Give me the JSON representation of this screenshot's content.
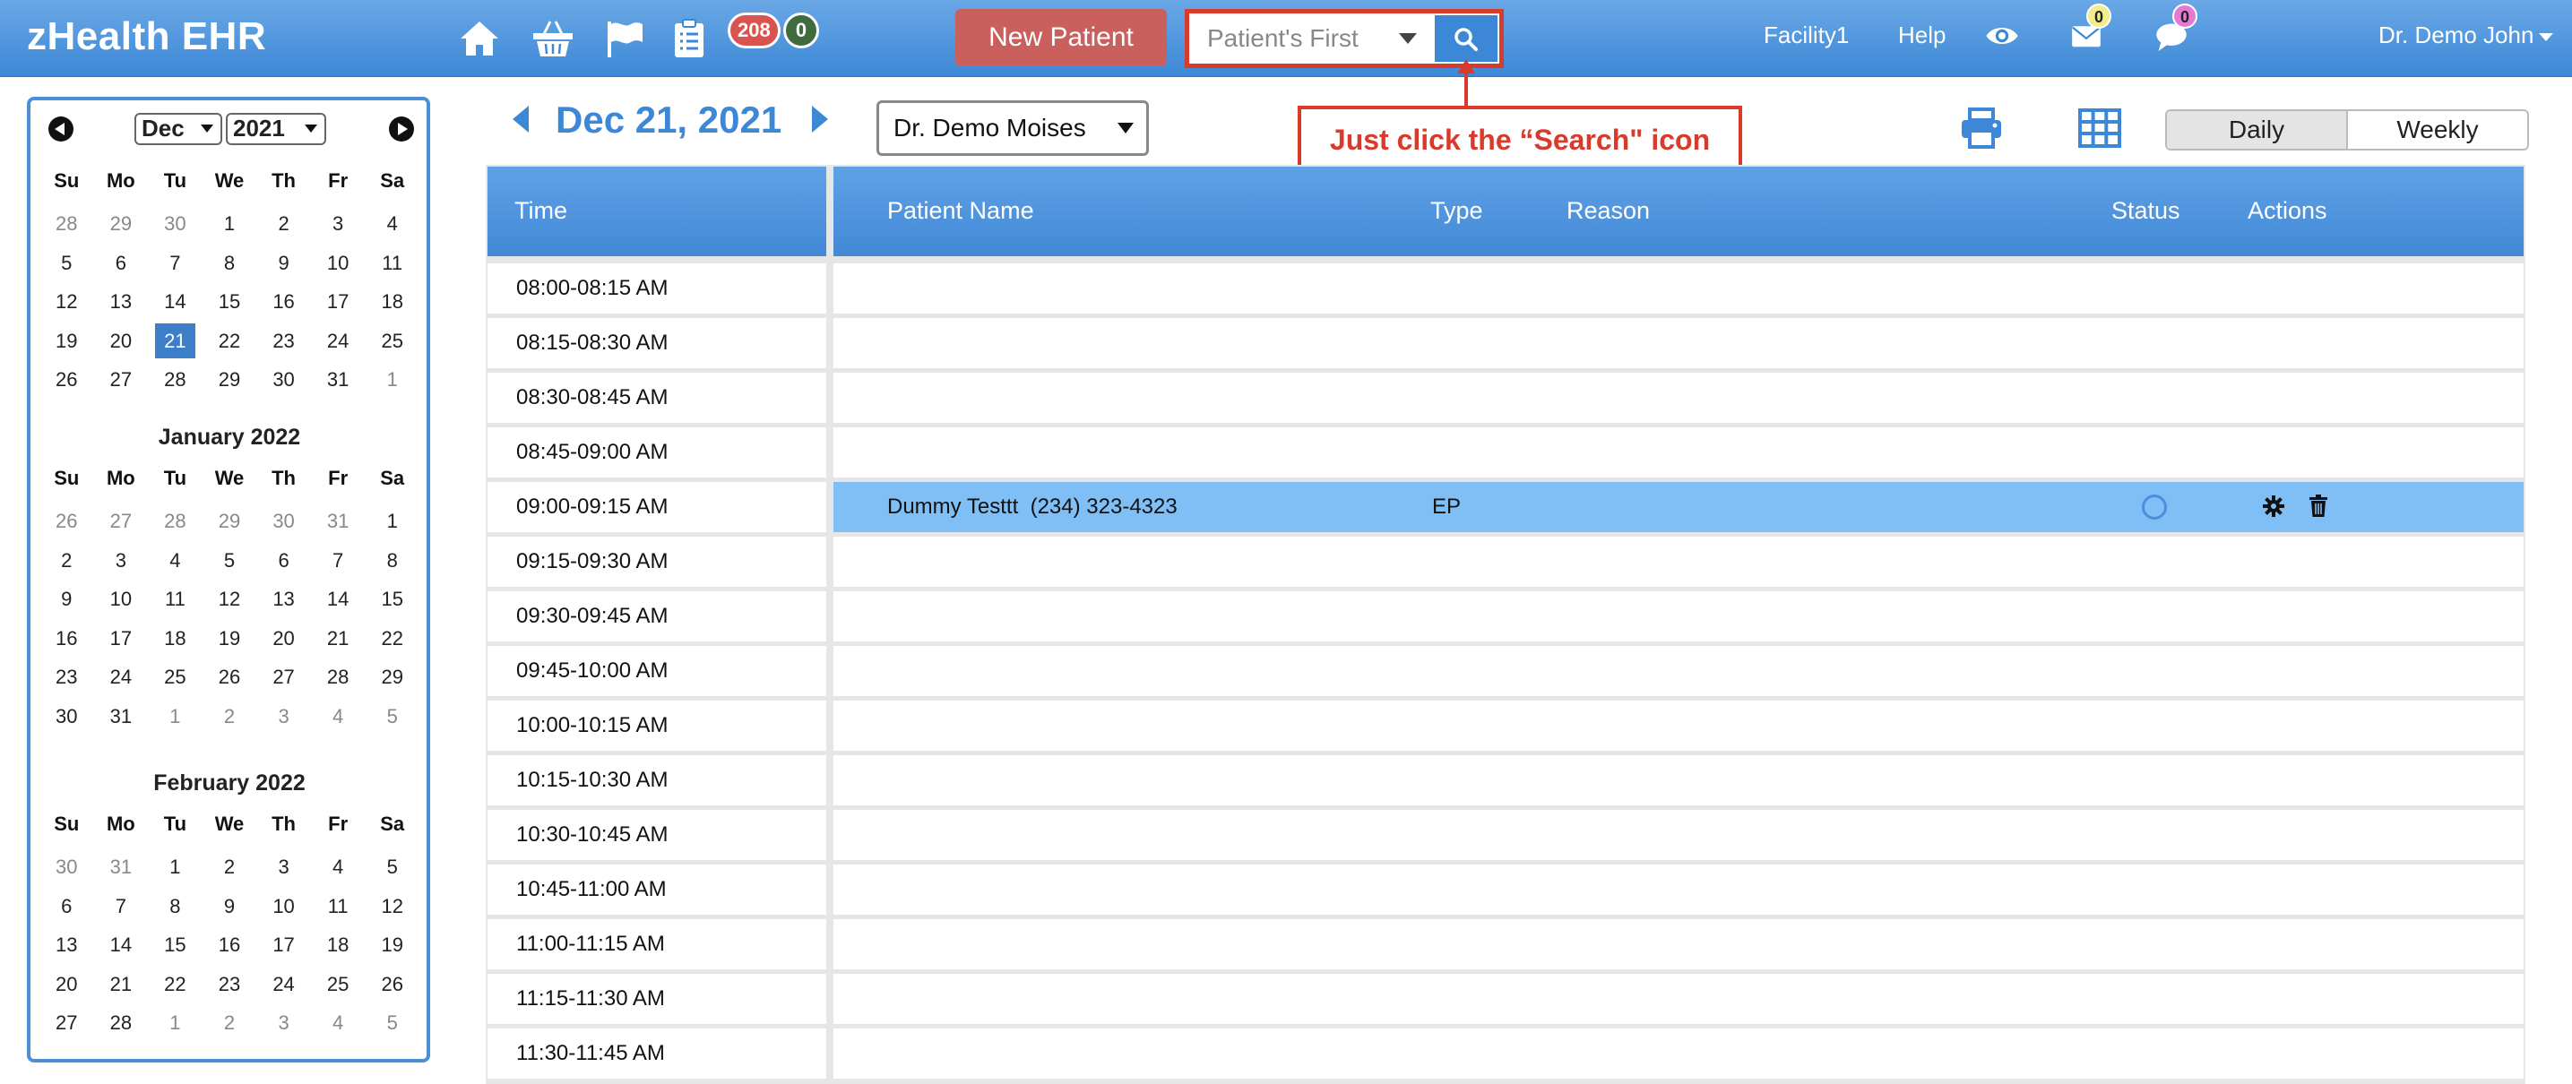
{
  "header": {
    "brand": "zHealth EHR",
    "badge_red": "208",
    "badge_green": "0",
    "new_patient_label": "New Patient",
    "search_placeholder": "Patient's First",
    "facility": "Facility1",
    "help": "Help",
    "mail_count": "0",
    "chat_count": "0",
    "user": "Dr. Demo John"
  },
  "calendar": {
    "selected_month": "Dec",
    "selected_year": "2021",
    "weekdays": [
      "Su",
      "Mo",
      "Tu",
      "We",
      "Th",
      "Fr",
      "Sa"
    ],
    "months": [
      {
        "title": "",
        "days": [
          [
            "28",
            "m"
          ],
          [
            "29",
            "m"
          ],
          [
            "30",
            "m"
          ],
          [
            "1",
            ""
          ],
          [
            "2",
            ""
          ],
          [
            "3",
            ""
          ],
          [
            "4",
            ""
          ],
          [
            "5",
            ""
          ],
          [
            "6",
            ""
          ],
          [
            "7",
            ""
          ],
          [
            "8",
            ""
          ],
          [
            "9",
            ""
          ],
          [
            "10",
            ""
          ],
          [
            "11",
            ""
          ],
          [
            "12",
            ""
          ],
          [
            "13",
            ""
          ],
          [
            "14",
            ""
          ],
          [
            "15",
            ""
          ],
          [
            "16",
            ""
          ],
          [
            "17",
            ""
          ],
          [
            "18",
            ""
          ],
          [
            "19",
            ""
          ],
          [
            "20",
            ""
          ],
          [
            "21",
            "s"
          ],
          [
            "22",
            ""
          ],
          [
            "23",
            ""
          ],
          [
            "24",
            ""
          ],
          [
            "25",
            ""
          ],
          [
            "26",
            ""
          ],
          [
            "27",
            ""
          ],
          [
            "28",
            ""
          ],
          [
            "29",
            ""
          ],
          [
            "30",
            ""
          ],
          [
            "31",
            ""
          ],
          [
            "1",
            "m"
          ]
        ]
      },
      {
        "title": "January 2022",
        "days": [
          [
            "26",
            "m"
          ],
          [
            "27",
            "m"
          ],
          [
            "28",
            "m"
          ],
          [
            "29",
            "m"
          ],
          [
            "30",
            "m"
          ],
          [
            "31",
            "m"
          ],
          [
            "1",
            ""
          ],
          [
            "2",
            ""
          ],
          [
            "3",
            ""
          ],
          [
            "4",
            ""
          ],
          [
            "5",
            ""
          ],
          [
            "6",
            ""
          ],
          [
            "7",
            ""
          ],
          [
            "8",
            ""
          ],
          [
            "9",
            ""
          ],
          [
            "10",
            ""
          ],
          [
            "11",
            ""
          ],
          [
            "12",
            ""
          ],
          [
            "13",
            ""
          ],
          [
            "14",
            ""
          ],
          [
            "15",
            ""
          ],
          [
            "16",
            ""
          ],
          [
            "17",
            ""
          ],
          [
            "18",
            ""
          ],
          [
            "19",
            ""
          ],
          [
            "20",
            ""
          ],
          [
            "21",
            ""
          ],
          [
            "22",
            ""
          ],
          [
            "23",
            ""
          ],
          [
            "24",
            ""
          ],
          [
            "25",
            ""
          ],
          [
            "26",
            ""
          ],
          [
            "27",
            ""
          ],
          [
            "28",
            ""
          ],
          [
            "29",
            ""
          ],
          [
            "30",
            ""
          ],
          [
            "31",
            ""
          ],
          [
            "1",
            "m"
          ],
          [
            "2",
            "m"
          ],
          [
            "3",
            "m"
          ],
          [
            "4",
            "m"
          ],
          [
            "5",
            "m"
          ]
        ]
      },
      {
        "title": "February 2022",
        "days": [
          [
            "30",
            "m"
          ],
          [
            "31",
            "m"
          ],
          [
            "1",
            ""
          ],
          [
            "2",
            ""
          ],
          [
            "3",
            ""
          ],
          [
            "4",
            ""
          ],
          [
            "5",
            ""
          ],
          [
            "6",
            ""
          ],
          [
            "7",
            ""
          ],
          [
            "8",
            ""
          ],
          [
            "9",
            ""
          ],
          [
            "10",
            ""
          ],
          [
            "11",
            ""
          ],
          [
            "12",
            ""
          ],
          [
            "13",
            ""
          ],
          [
            "14",
            ""
          ],
          [
            "15",
            ""
          ],
          [
            "16",
            ""
          ],
          [
            "17",
            ""
          ],
          [
            "18",
            ""
          ],
          [
            "19",
            ""
          ],
          [
            "20",
            ""
          ],
          [
            "21",
            ""
          ],
          [
            "22",
            ""
          ],
          [
            "23",
            ""
          ],
          [
            "24",
            ""
          ],
          [
            "25",
            ""
          ],
          [
            "26",
            ""
          ],
          [
            "27",
            ""
          ],
          [
            "28",
            ""
          ],
          [
            "1",
            "m"
          ],
          [
            "2",
            "m"
          ],
          [
            "3",
            "m"
          ],
          [
            "4",
            "m"
          ],
          [
            "5",
            "m"
          ]
        ]
      }
    ]
  },
  "schedule": {
    "date": "Dec 21, 2021",
    "doctor": "Dr. Demo Moises",
    "callout": "Just click the “Search\" icon",
    "view_daily": "Daily",
    "view_weekly": "Weekly",
    "columns": {
      "time": "Time",
      "patient": "Patient Name",
      "type": "Type",
      "reason": "Reason",
      "status": "Status",
      "actions": "Actions"
    },
    "slots": [
      {
        "time": "08:00-08:15 AM",
        "patient": "",
        "type": ""
      },
      {
        "time": "08:15-08:30 AM",
        "patient": "",
        "type": ""
      },
      {
        "time": "08:30-08:45 AM",
        "patient": "",
        "type": ""
      },
      {
        "time": "08:45-09:00 AM",
        "patient": "",
        "type": ""
      },
      {
        "time": "09:00-09:15 AM",
        "patient": "Dummy Testtt  (234) 323-4323",
        "type": "EP"
      },
      {
        "time": "09:15-09:30 AM",
        "patient": "",
        "type": ""
      },
      {
        "time": "09:30-09:45 AM",
        "patient": "",
        "type": ""
      },
      {
        "time": "09:45-10:00 AM",
        "patient": "",
        "type": ""
      },
      {
        "time": "10:00-10:15 AM",
        "patient": "",
        "type": ""
      },
      {
        "time": "10:15-10:30 AM",
        "patient": "",
        "type": ""
      },
      {
        "time": "10:30-10:45 AM",
        "patient": "",
        "type": ""
      },
      {
        "time": "10:45-11:00 AM",
        "patient": "",
        "type": ""
      },
      {
        "time": "11:00-11:15 AM",
        "patient": "",
        "type": ""
      },
      {
        "time": "11:15-11:30 AM",
        "patient": "",
        "type": ""
      },
      {
        "time": "11:30-11:45 AM",
        "patient": "",
        "type": ""
      }
    ]
  }
}
